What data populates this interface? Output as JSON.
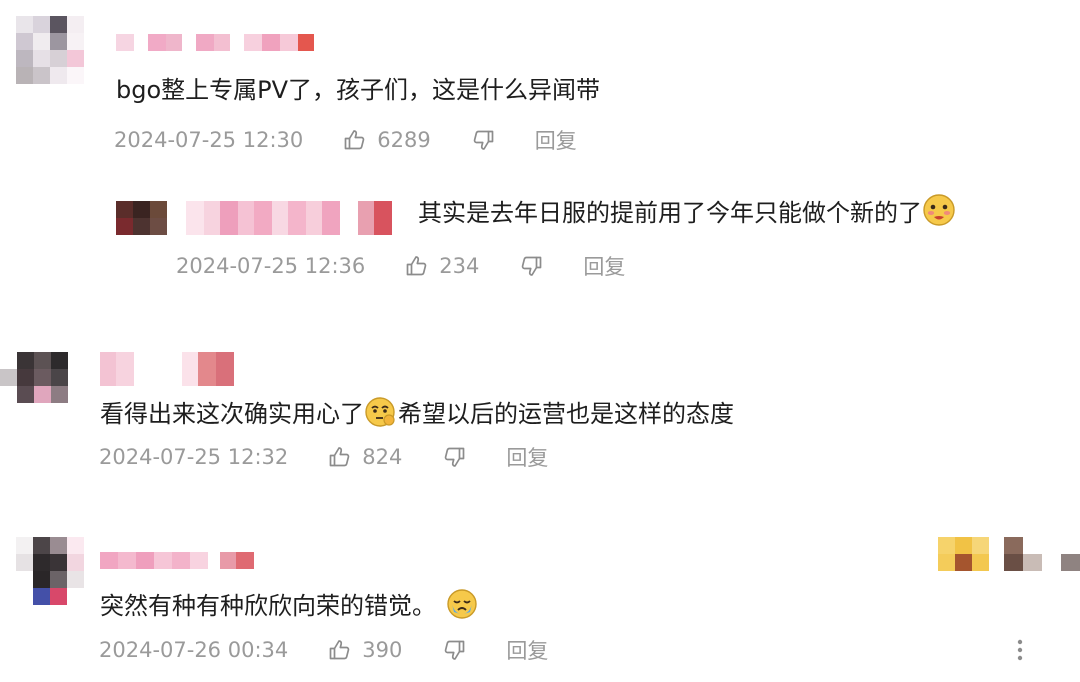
{
  "comments": [
    {
      "text": "bgo整上专属PV了，孩子们，这是什么异闻带",
      "time": "2024-07-25 12:30",
      "likes": "6289",
      "reply_label": "回复",
      "replies": [
        {
          "text": "其实是去年日服的提前用了今年只能做个新的了",
          "emoji": "blushing-face-icon",
          "time": "2024-07-25 12:36",
          "likes": "234",
          "reply_label": "回复"
        }
      ]
    },
    {
      "text_before": "看得出来这次确实用心了",
      "emoji": "thinking-face-icon",
      "text_after": "希望以后的运营也是这样的态度",
      "time": "2024-07-25 12:32",
      "likes": "824",
      "reply_label": "回复"
    },
    {
      "text": "突然有种有种欣欣向荣的错觉。",
      "emoji": "crying-face-icon",
      "time": "2024-07-26 00:34",
      "likes": "390",
      "reply_label": "回复"
    }
  ],
  "icons": {
    "like": "thumbs-up-icon",
    "dislike": "thumbs-down-icon",
    "more": "more-vertical-icon"
  },
  "colors": {
    "meta_text": "#9a9a9a",
    "body_text": "#1e1e1e",
    "emoji_yellow": "#f6c94a"
  }
}
